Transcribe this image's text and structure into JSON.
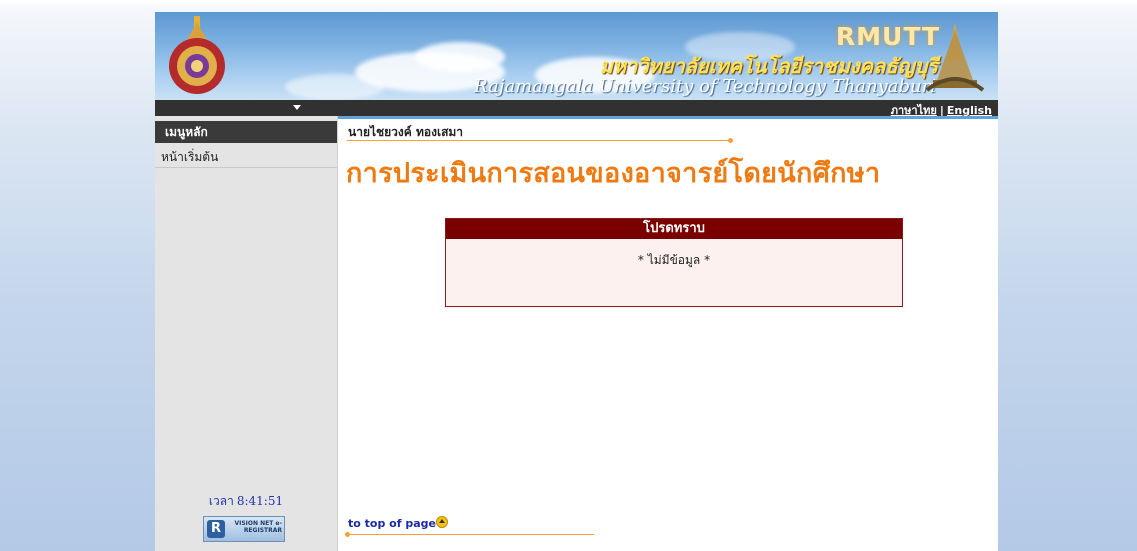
{
  "banner": {
    "brand": "RMUTT",
    "thai_name": "มหาวิทยาลัยเทคโนโลยีราชมงคลธัญบุรี",
    "english_name": "Rajamangala University of Technology Thanyaburi"
  },
  "topbar": {
    "lang_thai": "ภาษาไทย",
    "lang_separator": "|",
    "lang_english": "English"
  },
  "sidebar": {
    "menu_header": "เมนูหลัก",
    "items": [
      {
        "label": "หน้าเริ่มต้น"
      }
    ],
    "clock_label": "เวลา",
    "clock_time": "8:41:51",
    "badge": {
      "letter": "R",
      "text": "VISION NET e-REGISTRAR"
    }
  },
  "main": {
    "user_name": "นายไชยวงค์ ทองเสมา",
    "page_title": "การประเมินการสอนของอาจารย์โดยนักศึกษา",
    "notice": {
      "header": "โปรดทราบ",
      "message": "* ไม่มีข้อมูล *"
    },
    "to_top_label": "to top of page"
  },
  "colors": {
    "title_orange": "#f07a12",
    "notice_header": "#7a0000",
    "link_blue": "#1a2aa8",
    "topbar": "#313131"
  }
}
